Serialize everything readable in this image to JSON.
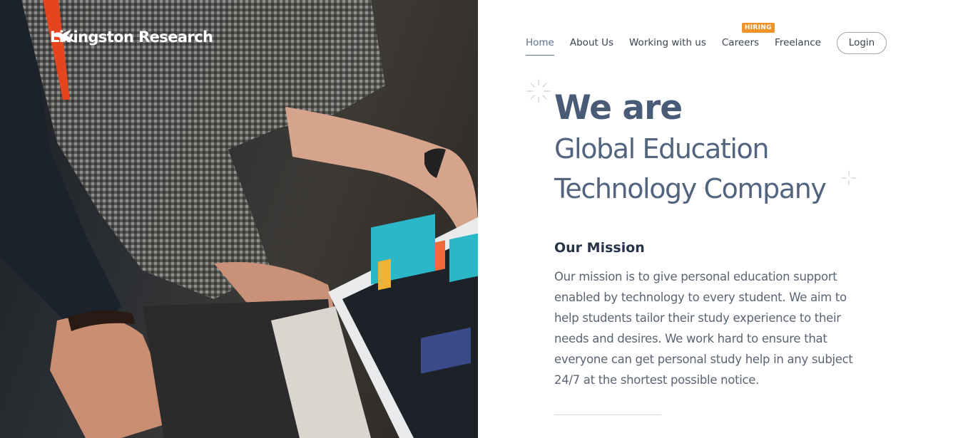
{
  "brand": {
    "name": "Livingston Research",
    "logo_icon": "seagull-icon"
  },
  "nav": {
    "items": [
      {
        "label": "Home",
        "active": true
      },
      {
        "label": "About Us",
        "active": false
      },
      {
        "label": "Working with us",
        "active": false
      },
      {
        "label": "Careers",
        "active": false,
        "badge": "HIRING"
      },
      {
        "label": "Freelance",
        "active": false
      }
    ],
    "login_label": "Login"
  },
  "hero": {
    "line1": "We are",
    "line2": "Global Education",
    "line3": "Technology Company"
  },
  "mission": {
    "title": "Our Mission",
    "body": "Our mission is to give personal education support enabled by technology to every student. We aim to help students tailor their study experience to their needs and desires. We work hard to ensure that everyone can get personal study help in any subject 24/7 at the shortest possible notice."
  },
  "colors": {
    "accent": "#4a5b78",
    "badge": "#f0932b",
    "text": "#5a6472"
  }
}
